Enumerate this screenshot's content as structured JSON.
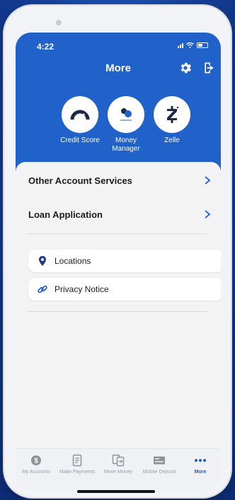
{
  "status_bar": {
    "time": "4:22"
  },
  "header": {
    "title": "More"
  },
  "shortcuts": [
    {
      "label": "Credit Score",
      "icon": "gauge-icon"
    },
    {
      "label": "Money Manager",
      "icon": "money-manager-icon"
    },
    {
      "label": "Zelle",
      "icon": "zelle-icon"
    }
  ],
  "menu": {
    "rows": [
      {
        "label": "Other Account Services"
      },
      {
        "label": "Loan Application"
      }
    ],
    "cards": [
      {
        "label": "Locations",
        "icon": "location-pin-icon"
      },
      {
        "label": "Privacy Notice",
        "icon": "link-icon"
      }
    ]
  },
  "tabbar": {
    "tabs": [
      {
        "label": "My Accounts",
        "icon": "dollar-coin-icon"
      },
      {
        "label": "Make Payments",
        "icon": "invoice-icon"
      },
      {
        "label": "Move Money",
        "icon": "transfer-icon"
      },
      {
        "label": "Mobile Deposit",
        "icon": "check-icon"
      },
      {
        "label": "More",
        "icon": "more-dots-icon",
        "active": true
      }
    ]
  },
  "colors": {
    "brand_blue": "#2062c9",
    "active_tab": "#1f5cc5",
    "inactive_tab": "#9a9da5"
  }
}
